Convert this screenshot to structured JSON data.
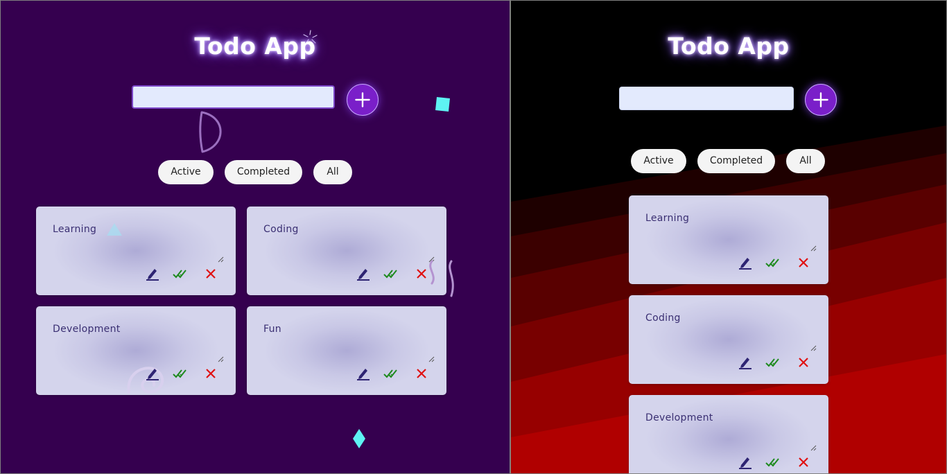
{
  "left": {
    "title": "Todo App",
    "input": {
      "value": "",
      "placeholder": ""
    },
    "filters": [
      "Active",
      "Completed",
      "All"
    ],
    "cards": [
      "Learning",
      "Coding",
      "Development",
      "Fun"
    ]
  },
  "right": {
    "title": "Todo App",
    "input": {
      "value": "",
      "placeholder": ""
    },
    "filters": [
      "Active",
      "Completed",
      "All"
    ],
    "cards": [
      "Learning",
      "Coding",
      "Development"
    ]
  },
  "icons": {
    "add": "plus-icon",
    "edit": "pencil-icon",
    "complete": "double-check-icon",
    "delete": "close-icon"
  },
  "colors": {
    "left_background": "#35004f",
    "right_background": "#000000",
    "right_stripes": [
      "#1e0000",
      "#3b0000",
      "#590000",
      "#780000",
      "#970000",
      "#b00000"
    ],
    "accent": "#7a1fc9",
    "input": "#e3eafd",
    "card": "#c9c8e6",
    "card_text": "#3a2f72",
    "edit_icon": "#2e2473",
    "check_icon": "#1e8a1e",
    "delete_icon": "#e01010",
    "decor_cyan": "#5ef3f3",
    "decor_lilac": "#b493d0"
  }
}
